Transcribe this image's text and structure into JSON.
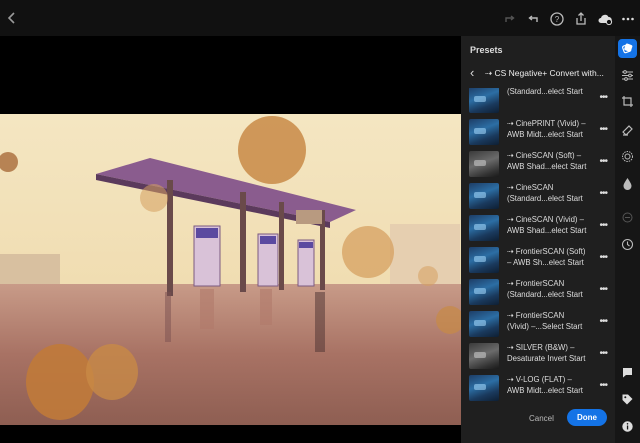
{
  "topbar": {
    "icons": [
      "back-chevron-icon",
      "redo-icon",
      "undo-icon",
      "help-icon",
      "share-icon",
      "cloud-sync-icon",
      "more-icon"
    ]
  },
  "panel": {
    "title": "Presets",
    "breadcrumb": "CS Negative+ Convert with...",
    "breadcrumb_prefix": "⇢ ",
    "items": [
      {
        "line1": "(Standard...elect Start",
        "line2": "",
        "thumb": "blue"
      },
      {
        "line1": "⇢ CinePRINT (Vivid) –",
        "line2": "AWB Midt...elect Start",
        "thumb": "blue"
      },
      {
        "line1": "⇢ CineSCAN (Soft) –",
        "line2": "AWB Shad...elect Start",
        "thumb": "blue"
      },
      {
        "line1": "⇢ CineSCAN",
        "line2": "(Standard...elect Start",
        "thumb": "blue"
      },
      {
        "line1": "⇢ CineSCAN (Vivid) –",
        "line2": "AWB Shad...elect Start",
        "thumb": "blue"
      },
      {
        "line1": "⇢ FrontierSCAN (Soft)",
        "line2": "– AWB Sh...elect Start",
        "thumb": "blue"
      },
      {
        "line1": "⇢ FrontierSCAN",
        "line2": "(Standard...elect Start",
        "thumb": "blue"
      },
      {
        "line1": "⇢ FrontierSCAN",
        "line2": "(Vivid) –...Select Start",
        "thumb": "blue"
      },
      {
        "line1": "⇢ SILVER (B&W) –",
        "line2": "Desaturate Invert Start",
        "thumb": "gray"
      },
      {
        "line1": "⇢ V-LOG (FLAT) –",
        "line2": "AWB Midt...elect Start",
        "thumb": "blue"
      }
    ],
    "more_label": "•••",
    "cancel_label": "Cancel",
    "done_label": "Done"
  },
  "toolstrip": {
    "tools": [
      "presets-icon",
      "edit-sliders-icon",
      "crop-icon",
      "healing-icon",
      "masking-icon",
      "geometry-icon",
      "versions-icon",
      "history-icon",
      "comments-icon",
      "tag-icon",
      "info-icon"
    ],
    "active": "presets-icon"
  },
  "colors": {
    "accent": "#1473e6",
    "panel_bg": "#1f1f1f",
    "toolstrip_bg": "#161616"
  }
}
